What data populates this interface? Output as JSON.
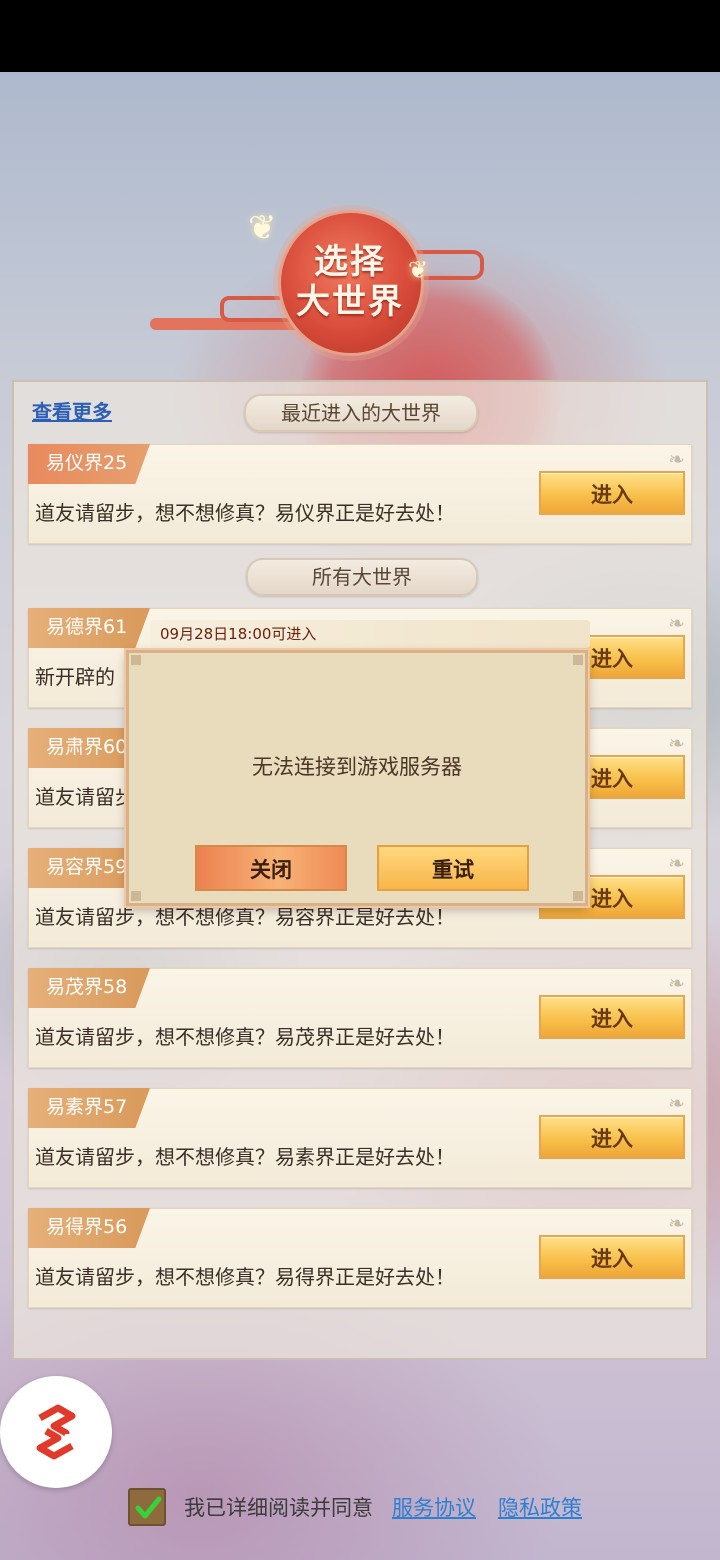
{
  "header": {
    "title": "选择\n大世界"
  },
  "panel": {
    "more_link": "查看更多",
    "recent_section": "最近进入的大世界",
    "all_section": "所有大世界",
    "enter_label": "进入"
  },
  "recent": [
    {
      "name": "易仪界25",
      "desc": "道友请留步，想不想修真？易仪界正是好去处！"
    }
  ],
  "worlds": [
    {
      "name": "易德界61",
      "desc": "新开辟的"
    },
    {
      "name": "易肃界60",
      "desc": "道友请留步"
    },
    {
      "name": "易容界59",
      "desc": "道友请留步，想不想修真？易容界正是好去处！"
    },
    {
      "name": "易茂界58",
      "desc": "道友请留步，想不想修真？易茂界正是好去处！"
    },
    {
      "name": "易素界57",
      "desc": "道友请留步，想不想修真？易素界正是好去处！"
    },
    {
      "name": "易得界56",
      "desc": "道友请留步，想不想修真？易得界正是好去处！"
    }
  ],
  "dialog": {
    "date_notice": "09月28日18:00可进入",
    "message": "无法连接到游戏服务器",
    "close_label": "关闭",
    "retry_label": "重试"
  },
  "footer": {
    "agree_text": "我已详细阅读并同意",
    "service_link": "服务协议",
    "privacy_link": "隐私政策"
  },
  "icons": {
    "logo": "app-logo-icon",
    "checkbox": "checkmark-icon",
    "butterfly": "butterfly-icon"
  },
  "colors": {
    "accent": "#f8c14b",
    "link": "#2f7fd1",
    "emblem_red": "#d84b3a"
  }
}
